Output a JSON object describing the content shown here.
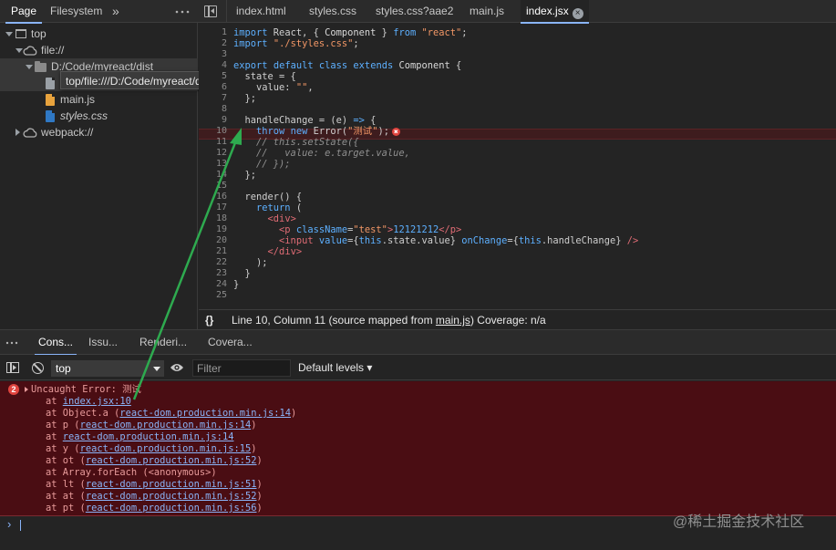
{
  "navigator": {
    "tabs": [
      "Page",
      "Filesystem"
    ],
    "more": "»",
    "tree": {
      "top": "top",
      "file": "file://",
      "dist": "D:/Code/myreact/dist",
      "tooltip": "top/file:///D:/Code/myreact/dist",
      "files": [
        "main.js",
        "styles.css"
      ],
      "webpack": "webpack://"
    },
    "colors": {
      "html_file": "#9aa0a6",
      "js_file": "#e8a33d",
      "css_file": "#2f78c4"
    }
  },
  "editor": {
    "tabs": [
      "index.html",
      "styles.css",
      "styles.css?aae2",
      "main.js",
      "index.jsx"
    ],
    "active_tab": "index.jsx",
    "close_glyph": "×",
    "line_numbers": [
      "1",
      "2",
      "3",
      "4",
      "5",
      "6",
      "7",
      "8",
      "9",
      "10",
      "11",
      "12",
      "13",
      "14",
      "15",
      "16",
      "17",
      "18",
      "19",
      "20",
      "21",
      "22",
      "23",
      "24",
      "25"
    ],
    "code": {
      "l1": [
        "import",
        " React, { ",
        "Component",
        " } ",
        "from",
        " ",
        "\"react\"",
        ";"
      ],
      "l2": [
        "import",
        " ",
        "\"./styles.css\"",
        ";"
      ],
      "l4": [
        "export",
        " ",
        "default",
        " ",
        "class",
        " ",
        "extends",
        " ",
        "Component",
        " {"
      ],
      "l5": "  state = {",
      "l6": [
        "    value: ",
        "\"\"",
        ","
      ],
      "l7": "  };",
      "l9": [
        "  handleChange = (e) ",
        "=>",
        " {"
      ],
      "l10": [
        "    ",
        "throw",
        " ",
        "new",
        " Error(",
        "\"测试\"",
        ");"
      ],
      "l11": "    // this.setState({",
      "l12": "    //   value: e.target.value,",
      "l13": "    // });",
      "l14": "  };",
      "l16": "  render() {",
      "l17": [
        "    ",
        "return",
        " ("
      ],
      "l18": [
        "      ",
        "<div>"
      ],
      "l19": [
        "        ",
        "<p",
        " ",
        "className",
        "=",
        "\"test\"",
        ">",
        "12121212",
        "</p>"
      ],
      "l20": [
        "        ",
        "<input",
        " ",
        "value",
        "={",
        "this",
        ".state.value} ",
        "onChange",
        "={",
        "this",
        ".handleChange} ",
        "/>"
      ],
      "l21": [
        "      ",
        "</div>"
      ],
      "l22": "    );",
      "l23": "  }",
      "l24": "}"
    },
    "error_badge": "✖"
  },
  "status_bar": {
    "braces": "{}",
    "position": "Line 10, Column 11",
    "source_prefix": "(source mapped from ",
    "source_link": "main.js",
    "source_suffix": ")",
    "coverage": "Coverage: n/a"
  },
  "drawer": {
    "tabs": [
      "Cons...",
      "Issu...",
      "Renderi...",
      "Covera..."
    ],
    "context": "top",
    "filter_placeholder": "Filter",
    "levels": "Default levels ▾"
  },
  "console": {
    "error_count": "2",
    "error_title": "Uncaught Error: 测试",
    "stack": [
      {
        "prefix": "at ",
        "fn": "",
        "link": "index.jsx:10",
        "suffix": ""
      },
      {
        "prefix": "at ",
        "fn": "Object.a (",
        "link": "react-dom.production.min.js:14",
        "suffix": ")"
      },
      {
        "prefix": "at ",
        "fn": "p (",
        "link": "react-dom.production.min.js:14",
        "suffix": ")"
      },
      {
        "prefix": "at ",
        "fn": "",
        "link": "react-dom.production.min.js:14",
        "suffix": ""
      },
      {
        "prefix": "at ",
        "fn": "y (",
        "link": "react-dom.production.min.js:15",
        "suffix": ")"
      },
      {
        "prefix": "at ",
        "fn": "ot (",
        "link": "react-dom.production.min.js:52",
        "suffix": ")"
      },
      {
        "prefix": "at ",
        "fn": "Array.forEach (<anonymous>)",
        "link": "",
        "suffix": ""
      },
      {
        "prefix": "at ",
        "fn": "lt (",
        "link": "react-dom.production.min.js:51",
        "suffix": ")"
      },
      {
        "prefix": "at ",
        "fn": "at (",
        "link": "react-dom.production.min.js:52",
        "suffix": ")"
      },
      {
        "prefix": "at ",
        "fn": "pt (",
        "link": "react-dom.production.min.js:56",
        "suffix": ")"
      }
    ],
    "prompt": "›"
  },
  "watermark": "@稀土掘金技术社区",
  "colors": {
    "accent": "#8ab4f8",
    "error": "#e0443e",
    "error_bg": "#4a0d13",
    "arrow": "#2eaa4f"
  }
}
